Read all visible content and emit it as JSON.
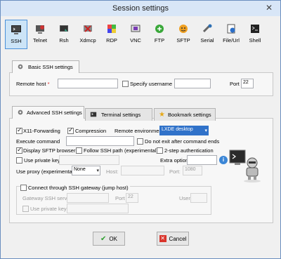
{
  "window": {
    "title": "Session settings"
  },
  "protocols": [
    {
      "label": "SSH",
      "icon": "ssh-icon",
      "selected": true
    },
    {
      "label": "Telnet",
      "icon": "telnet-icon"
    },
    {
      "label": "Rsh",
      "icon": "rsh-icon"
    },
    {
      "label": "Xdmcp",
      "icon": "xdmcp-icon"
    },
    {
      "label": "RDP",
      "icon": "rdp-icon"
    },
    {
      "label": "VNC",
      "icon": "vnc-icon"
    },
    {
      "label": "FTP",
      "icon": "ftp-icon"
    },
    {
      "label": "SFTP",
      "icon": "sftp-icon"
    },
    {
      "label": "Serial",
      "icon": "serial-icon"
    },
    {
      "label": "File/Url",
      "icon": "file-url-icon"
    },
    {
      "label": "Shell",
      "icon": "shell-icon"
    }
  ],
  "basic": {
    "tab_label": "Basic SSH settings",
    "remote_host_label": "Remote host",
    "required_mark": "*",
    "remote_host_value": "",
    "specify_username_label": "Specify username",
    "username_value": "",
    "port_label": "Port",
    "port_value": "22"
  },
  "tabs": {
    "advanced": "Advanced SSH settings",
    "terminal": "Terminal settings",
    "bookmark": "Bookmark settings"
  },
  "advanced": {
    "x11_label": "X11-Forwarding",
    "compression_label": "Compression",
    "remote_env_label": "Remote environment",
    "remote_env_value": "LXDE desktop",
    "exec_cmd_label": "Execute command",
    "exec_cmd_value": "",
    "no_exit_label": "Do not exit after command ends",
    "sftp_browser_label": "Display SFTP browser",
    "follow_path_label": "Follow SSH path (experimental)",
    "two_step_label": "2-step authentication",
    "private_key_label": "Use private key",
    "private_key_value": "",
    "extra_option_label": "Extra option",
    "extra_option_value": "",
    "proxy_label": "Use proxy (experimental):",
    "proxy_value": "None",
    "host_label": "Host:",
    "host_value": "",
    "proxy_port_label": "Port:",
    "proxy_port_value": "1080",
    "gateway_label": "Connect through SSH gateway (jump host)",
    "gateway_server_label": "Gateway SSH server",
    "gateway_server_value": "",
    "gateway_port_label": "Port",
    "gateway_port_value": "22",
    "gateway_user_label": "User",
    "gateway_user_value": "",
    "gateway_key_label": "Use private key",
    "gateway_key_value": ""
  },
  "buttons": {
    "ok": "OK",
    "cancel": "Cancel"
  },
  "colors": {
    "accent": "#4a90d9",
    "ok_green": "#2e9e2e",
    "cancel_red": "#d9342b",
    "env_highlight": "#3072c9"
  }
}
